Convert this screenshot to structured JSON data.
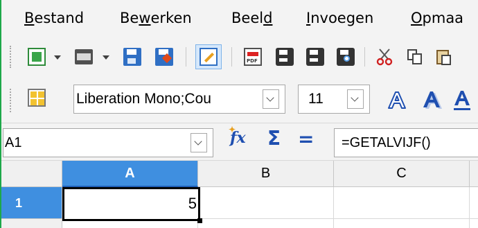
{
  "menubar": {
    "items": [
      {
        "pre": "",
        "mn": "B",
        "post": "estand"
      },
      {
        "pre": "Be",
        "mn": "w",
        "post": "erken"
      },
      {
        "pre": "Beel",
        "mn": "d",
        "post": ""
      },
      {
        "pre": "",
        "mn": "I",
        "post": "nvoegen"
      },
      {
        "pre": "",
        "mn": "O",
        "post": "pmaa"
      }
    ]
  },
  "toolbar_standard": {
    "icons": [
      "new-document-icon",
      "dropdown-arrow-icon",
      "open-folder-icon",
      "dropdown-arrow-icon",
      "save-icon",
      "save-as-icon",
      "edit-mode-icon",
      "export-pdf-icon",
      "print-icon",
      "print-direct-icon",
      "print-preview-icon",
      "cut-icon",
      "copy-icon",
      "paste-icon"
    ]
  },
  "toolbar_formatting": {
    "font_name": "Liberation Mono;Cou",
    "font_size": "11",
    "icons": [
      "styles-icon",
      "outline-font-icon",
      "shadow-font-icon",
      "underline-font-icon"
    ]
  },
  "formula_bar": {
    "name_box": "A1",
    "formula": "=GETALVIJF()",
    "icons": [
      "function-wizard-icon",
      "sum-icon",
      "formula-equals-icon"
    ]
  },
  "sheet": {
    "columns": [
      "A",
      "B",
      "C"
    ],
    "rows": [
      "1"
    ],
    "cells": {
      "A1": "5",
      "B1": "",
      "C1": ""
    },
    "active_cell": "A1",
    "selection_color": "#3f8fe0"
  },
  "colors": {
    "window_border": "#1ea84a",
    "icon_blue": "#1f4fb0",
    "toolbar_bg": "#f3f3f3"
  }
}
